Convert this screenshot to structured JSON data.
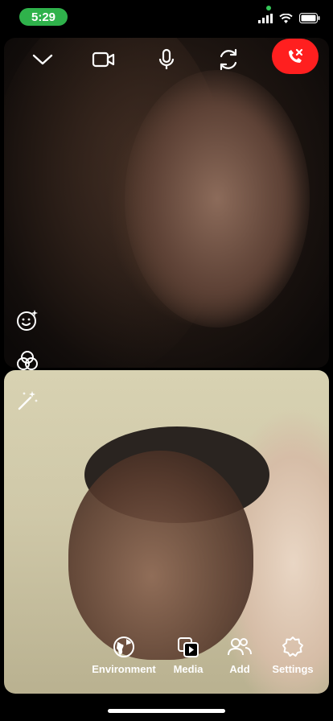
{
  "status_bar": {
    "time": "5:29"
  },
  "call_controls": {
    "collapse": "chevron-down-icon",
    "video": "video-camera-icon",
    "mic": "microphone-icon",
    "flip": "camera-flip-icon",
    "end": "end-call-icon"
  },
  "toolbar": {
    "items": [
      {
        "label": "Environment",
        "icon": "globe-icon"
      },
      {
        "label": "Media",
        "icon": "media-icon"
      },
      {
        "label": "Add",
        "icon": "add-people-icon"
      },
      {
        "label": "Settings",
        "icon": "gear-icon"
      }
    ]
  },
  "colors": {
    "end_call": "#ff1f1f",
    "time_pill": "#2fb24b"
  }
}
